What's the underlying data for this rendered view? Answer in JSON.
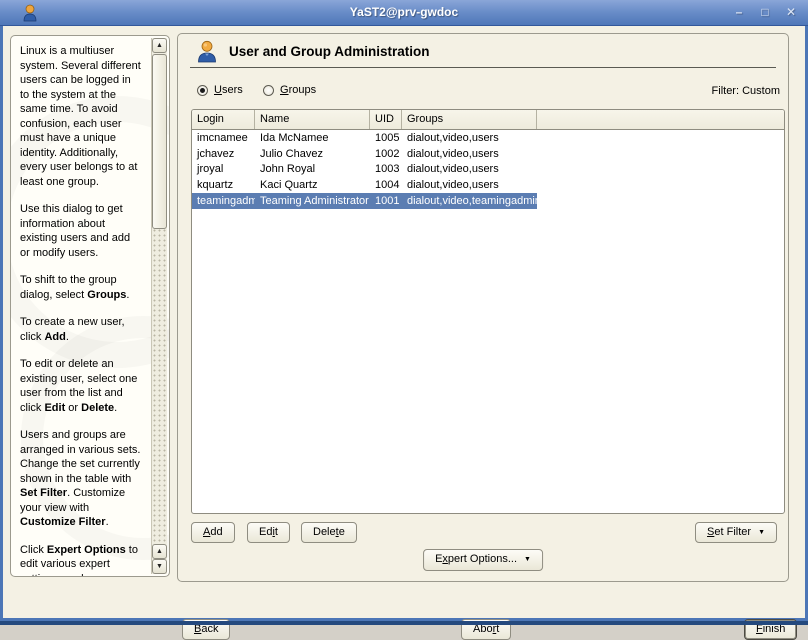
{
  "window": {
    "title": "YaST2@prv-gwdoc",
    "controls": {
      "minimize": "–",
      "maximize": "□",
      "close": "✕"
    }
  },
  "colors": {
    "titlebar_blue": "#5f84c2",
    "selection_blue": "#5b7db2",
    "background_beige": "#f4f1e4",
    "head_orange": "#eea53e",
    "body_blue": "#2f5da8"
  },
  "help_panel": {
    "paragraphs": [
      [
        {
          "t": "Linux is a multiuser system. Several different users can be logged in to the system at the same time. To avoid confusion, each user must have a unique identity. Additionally, every user belongs to at least one group.",
          "b": false
        }
      ],
      [
        {
          "t": "Use this dialog to get information about existing users and add or modify users.",
          "b": false
        }
      ],
      [
        {
          "t": "To shift to the group dialog, select ",
          "b": false
        },
        {
          "t": "Groups",
          "b": true
        },
        {
          "t": ".",
          "b": false
        }
      ],
      [
        {
          "t": "To create a new user, click ",
          "b": false
        },
        {
          "t": "Add",
          "b": true
        },
        {
          "t": ".",
          "b": false
        }
      ],
      [
        {
          "t": "To edit or delete an existing user, select one user from the list and click ",
          "b": false
        },
        {
          "t": "Edit",
          "b": true
        },
        {
          "t": " or ",
          "b": false
        },
        {
          "t": "Delete",
          "b": true
        },
        {
          "t": ".",
          "b": false
        }
      ],
      [
        {
          "t": "Users and groups are arranged in various sets. Change the set currently shown in the table with ",
          "b": false
        },
        {
          "t": "Set Filter",
          "b": true
        },
        {
          "t": ". Customize your view with ",
          "b": false
        },
        {
          "t": "Customize Filter",
          "b": true
        },
        {
          "t": ".",
          "b": false
        }
      ],
      [
        {
          "t": "Click ",
          "b": false
        },
        {
          "t": "Expert Options",
          "b": true
        },
        {
          "t": " to edit various expert settings, such as password encryption type, user",
          "b": false
        }
      ]
    ]
  },
  "main": {
    "title": "User and Group Administration",
    "radios": [
      {
        "label": "Users",
        "accel": 0,
        "selected": true
      },
      {
        "label": "Groups",
        "accel": 0,
        "selected": false
      }
    ],
    "filter_label": "Filter: Custom",
    "table": {
      "columns": [
        "Login",
        "Name",
        "UID",
        "Groups",
        ""
      ],
      "rows": [
        {
          "login": "imcnamee",
          "name": "Ida McNamee",
          "uid": "1005",
          "groups": "dialout,video,users",
          "selected": false
        },
        {
          "login": "jchavez",
          "name": "Julio Chavez",
          "uid": "1002",
          "groups": "dialout,video,users",
          "selected": false
        },
        {
          "login": "jroyal",
          "name": "John Royal",
          "uid": "1003",
          "groups": "dialout,video,users",
          "selected": false
        },
        {
          "login": "kquartz",
          "name": "Kaci Quartz",
          "uid": "1004",
          "groups": "dialout,video,users",
          "selected": false
        },
        {
          "login": "teamingadmin",
          "name": "Teaming Administrator",
          "uid": "1001",
          "groups": "dialout,video,teamingadmin",
          "selected": true
        }
      ]
    },
    "buttons": {
      "add": {
        "label": "Add",
        "accel": 0
      },
      "edit": {
        "label": "Edit",
        "accel": 2
      },
      "delete": {
        "label": "Delete",
        "accel": 4
      },
      "set_filter": {
        "label": "Set Filter",
        "accel": 0,
        "arrow": "▼"
      },
      "expert_options": {
        "label": "Expert Options...",
        "accel": 1,
        "arrow": "▼"
      }
    }
  },
  "footer": {
    "back": {
      "label": "Back",
      "accel": 0
    },
    "abort": {
      "label": "Abort",
      "accel": 3
    },
    "finish": {
      "label": "Finish",
      "accel": 0
    }
  }
}
